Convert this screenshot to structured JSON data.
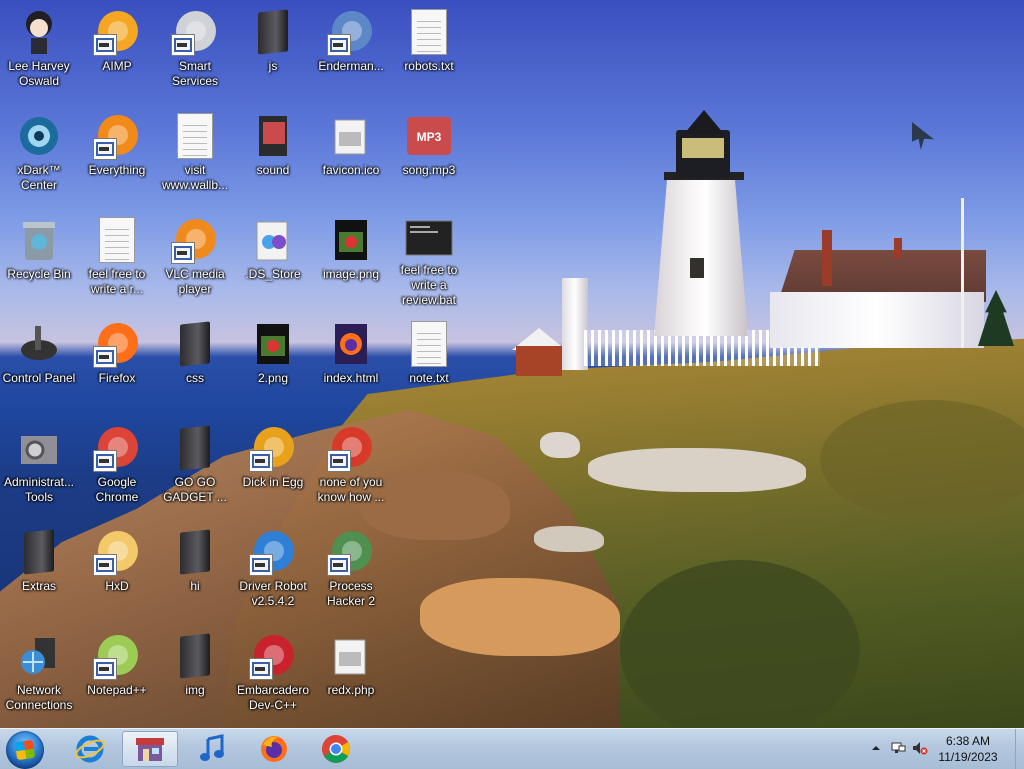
{
  "desktop_icons": [
    {
      "label": "Lee Harvey Oswald",
      "icon": "anime-avatar-icon"
    },
    {
      "label": "AIMP",
      "icon": "aimp-icon"
    },
    {
      "label": "Smart Services",
      "icon": "gears-icon"
    },
    {
      "label": "js",
      "icon": "folder-icon"
    },
    {
      "label": "Enderman...",
      "icon": "app-window-icon"
    },
    {
      "label": "robots.txt",
      "icon": "text-file-icon"
    },
    {
      "label": "xDark™ Center",
      "icon": "xdark-icon"
    },
    {
      "label": "Everything",
      "icon": "search-orange-icon"
    },
    {
      "label": "visit www.wallb...",
      "icon": "text-file-icon"
    },
    {
      "label": "sound",
      "icon": "folder-mp3-icon"
    },
    {
      "label": "favicon.ico",
      "icon": "generic-file-icon"
    },
    {
      "label": "song.mp3",
      "icon": "mp3-file-icon"
    },
    {
      "label": "Recycle Bin",
      "icon": "recycle-bin-icon"
    },
    {
      "label": "feel free to write a r...",
      "icon": "text-file-icon"
    },
    {
      "label": "VLC media player",
      "icon": "vlc-icon"
    },
    {
      "label": ".DS_Store",
      "icon": "ds-store-icon"
    },
    {
      "label": "image.png",
      "icon": "image-file-icon"
    },
    {
      "label": "feel free to write a review.bat",
      "icon": "bat-file-icon"
    },
    {
      "label": "Control Panel",
      "icon": "control-panel-icon"
    },
    {
      "label": "Firefox",
      "icon": "firefox-icon"
    },
    {
      "label": "css",
      "icon": "folder-icon"
    },
    {
      "label": "2.png",
      "icon": "image-file-icon"
    },
    {
      "label": "index.html",
      "icon": "firefox-html-icon"
    },
    {
      "label": "note.txt",
      "icon": "text-file-icon"
    },
    {
      "label": "Administrat... Tools",
      "icon": "admin-tools-icon"
    },
    {
      "label": "Google Chrome",
      "icon": "chrome-icon"
    },
    {
      "label": "GO GO GADGET ...",
      "icon": "folder-icon"
    },
    {
      "label": "Dick in Egg",
      "icon": "egg-app-icon"
    },
    {
      "label": "none of you know how ...",
      "icon": "pokeball-icon"
    },
    {
      "label": "Extras",
      "icon": "folder-icon"
    },
    {
      "label": "HxD",
      "icon": "hxd-icon"
    },
    {
      "label": "hi",
      "icon": "folder-icon"
    },
    {
      "label": "Driver Robot v2.5.4.2",
      "icon": "shield-icon"
    },
    {
      "label": "Process Hacker 2",
      "icon": "process-hacker-icon"
    },
    {
      "label": "Network Connections",
      "icon": "network-icon"
    },
    {
      "label": "Notepad++",
      "icon": "notepadpp-icon"
    },
    {
      "label": "img",
      "icon": "folder-icon"
    },
    {
      "label": "Embarcadero Dev-C++",
      "icon": "devcpp-icon"
    },
    {
      "label": "redx.php",
      "icon": "generic-file-icon"
    }
  ],
  "taskbar": {
    "start_icon": "windows-start-icon",
    "pinned": [
      {
        "name": "internet-explorer",
        "icon": "ie-icon"
      },
      {
        "name": "store-app",
        "icon": "store-icon",
        "active": true
      },
      {
        "name": "music-player",
        "icon": "music-note-icon"
      },
      {
        "name": "firefox",
        "icon": "firefox-icon"
      },
      {
        "name": "chrome",
        "icon": "chrome-icon"
      }
    ],
    "tray": {
      "icons": [
        "chevron-up-icon",
        "network-tray-icon",
        "volume-muted-icon"
      ],
      "time": "6:38 AM",
      "date": "11/19/2023"
    }
  },
  "colors": {
    "taskbar": "#b3c7de",
    "sky": "#5b78d8",
    "ocean": "#1f47a0"
  }
}
